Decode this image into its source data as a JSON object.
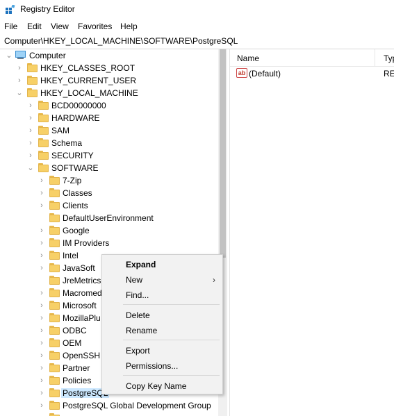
{
  "window": {
    "title": "Registry Editor"
  },
  "menu": [
    "File",
    "Edit",
    "View",
    "Favorites",
    "Help"
  ],
  "address": "Computer\\HKEY_LOCAL_MACHINE\\SOFTWARE\\PostgreSQL",
  "tree": {
    "root": "Computer",
    "hives": [
      "HKEY_CLASSES_ROOT",
      "HKEY_CURRENT_USER",
      "HKEY_LOCAL_MACHINE"
    ],
    "hklm_children": [
      "BCD00000000",
      "HARDWARE",
      "SAM",
      "Schema",
      "SECURITY",
      "SOFTWARE"
    ],
    "software_children": [
      "7-Zip",
      "Classes",
      "Clients",
      "DefaultUserEnvironment",
      "Google",
      "IM Providers",
      "Intel",
      "JavaSoft",
      "JreMetrics",
      "Macromed",
      "Microsoft",
      "MozillaPlu",
      "ODBC",
      "OEM",
      "OpenSSH",
      "Partner",
      "Policies",
      "PostgreSQL",
      "PostgreSQL Global Development Group"
    ],
    "selected": "PostgreSQL"
  },
  "list": {
    "columns": {
      "name": "Name",
      "type": "Typ"
    },
    "rows": [
      {
        "name": "(Default)",
        "type": "REG"
      }
    ]
  },
  "context_menu": {
    "items": [
      "Expand",
      "New",
      "Find...",
      "Delete",
      "Rename",
      "Export",
      "Permissions...",
      "Copy Key Name"
    ]
  },
  "colors": {
    "selection": "#cce8ff",
    "folder": "#f7d067"
  }
}
